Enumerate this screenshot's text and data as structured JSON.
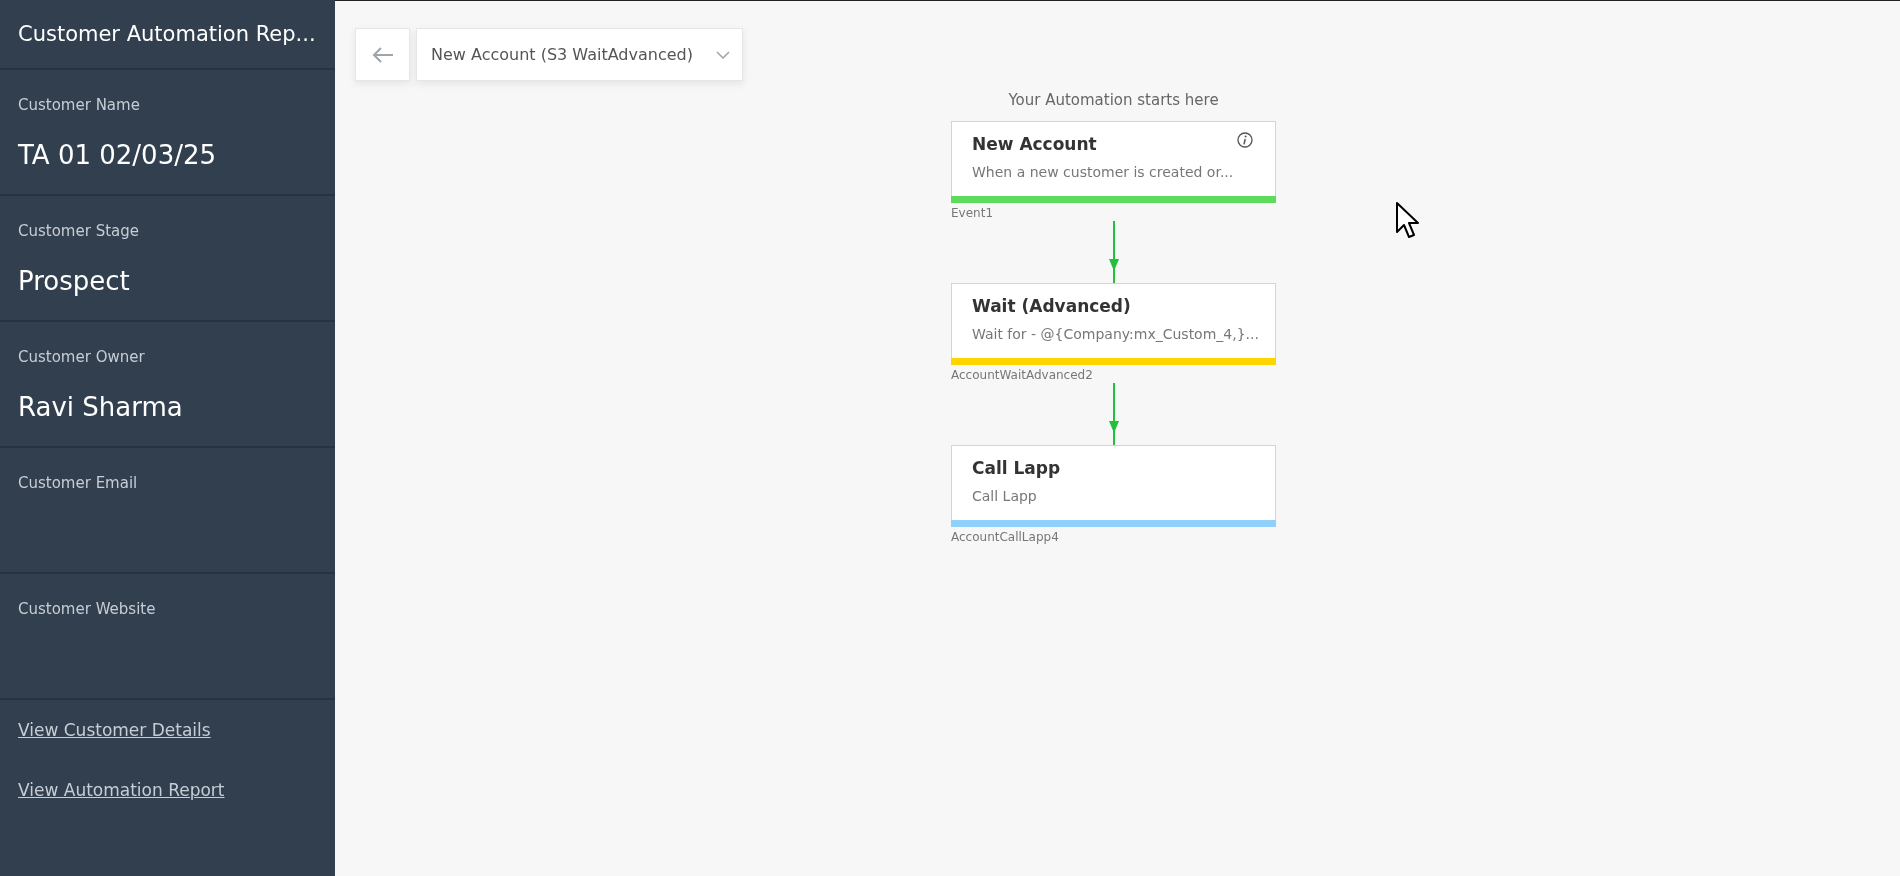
{
  "sidebar": {
    "title": "Customer Automation Rep...",
    "fields": [
      {
        "label": "Customer Name",
        "value": "TA 01 02/03/25"
      },
      {
        "label": "Customer Stage",
        "value": "Prospect"
      },
      {
        "label": "Customer Owner",
        "value": "Ravi Sharma"
      },
      {
        "label": "Customer Email"
      },
      {
        "label": "Customer Website"
      }
    ],
    "links": [
      "View Customer Details",
      "View Automation Report"
    ]
  },
  "toolbar": {
    "selector": "New Account (S3 WaitAdvanced)"
  },
  "flow": {
    "heading": "Your Automation starts here",
    "nodes": [
      {
        "title": "New Account",
        "description": "When a new customer is created or...",
        "id_label": "Event1",
        "color": "#5cdb5c",
        "info": true
      },
      {
        "title": "Wait (Advanced)",
        "description": "Wait for - @{Company:mx_Custom_4,}...",
        "id_label": "AccountWaitAdvanced2",
        "color": "#ffd500",
        "info": false
      },
      {
        "title": "Call Lapp",
        "description": "Call Lapp",
        "id_label": "AccountCallLapp4",
        "color": "#90d0fa",
        "info": false
      }
    ]
  }
}
